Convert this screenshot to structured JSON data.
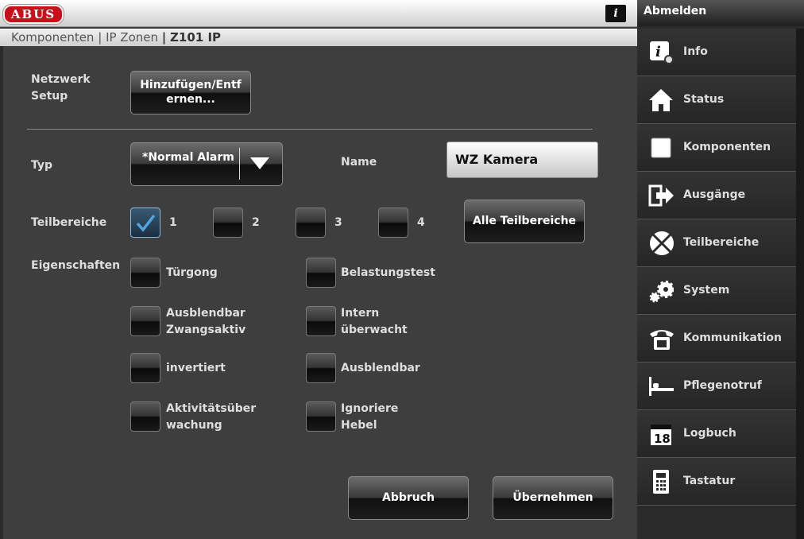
{
  "header": {
    "logo_text": "ABUS",
    "user_icon": "user-info-icon"
  },
  "breadcrumb": {
    "part1": "Komponenten",
    "sep1": "|",
    "part2": "IP Zonen",
    "sep2": "|",
    "current": "Z101 IP"
  },
  "form": {
    "network_label_1": "Netzwerk",
    "network_label_2": "Setup",
    "add_remove_line1": "Hinzufügen/Entf",
    "add_remove_line2": "ernen...",
    "type_label": "Typ",
    "type_value": "*Normal Alarm",
    "name_label": "Name",
    "name_value": "WZ Kamera",
    "partitions_label": "Teilbereiche",
    "partitions": [
      {
        "label": "1",
        "checked": true
      },
      {
        "label": "2",
        "checked": false
      },
      {
        "label": "3",
        "checked": false
      },
      {
        "label": "4",
        "checked": false
      }
    ],
    "all_partitions_button": "Alle Teilbereiche",
    "properties_label": "Eigenschaften",
    "properties": {
      "turgong": "Türgong",
      "belastungstest": "Belastungstest",
      "ausblendbar_zwang_1": "Ausblendbar",
      "ausblendbar_zwang_2": "Zwangsaktiv",
      "intern_1": "Intern",
      "intern_2": "überwacht",
      "invertiert": "invertiert",
      "ausblendbar": "Ausblendbar",
      "aktivitat_1": "Aktivitätsüber",
      "aktivitat_2": "wachung",
      "ignoriere_1": "Ignoriere",
      "ignoriere_2": "Hebel"
    },
    "cancel_button": "Abbruch",
    "apply_button": "Übernehmen"
  },
  "sidebar": {
    "logout": "Abmelden",
    "items": [
      {
        "label": "Info",
        "icon": "info-gear-icon"
      },
      {
        "label": "Status",
        "icon": "house-icon"
      },
      {
        "label": "Komponenten",
        "icon": "square-icon"
      },
      {
        "label": "Ausgänge",
        "icon": "exit-arrow-icon"
      },
      {
        "label": "Teilbereiche",
        "icon": "partition-pie-icon"
      },
      {
        "label": "System",
        "icon": "gears-icon"
      },
      {
        "label": "Kommunikation",
        "icon": "telephone-icon"
      },
      {
        "label": "Pflegenotruf",
        "icon": "bed-icon"
      },
      {
        "label": "Logbuch",
        "icon": "calendar-icon"
      },
      {
        "label": "Tastatur",
        "icon": "keypad-icon"
      }
    ],
    "calendar_day": "18"
  },
  "colors": {
    "brand": "#c8101d",
    "check_accent": "#4fa3e0"
  }
}
